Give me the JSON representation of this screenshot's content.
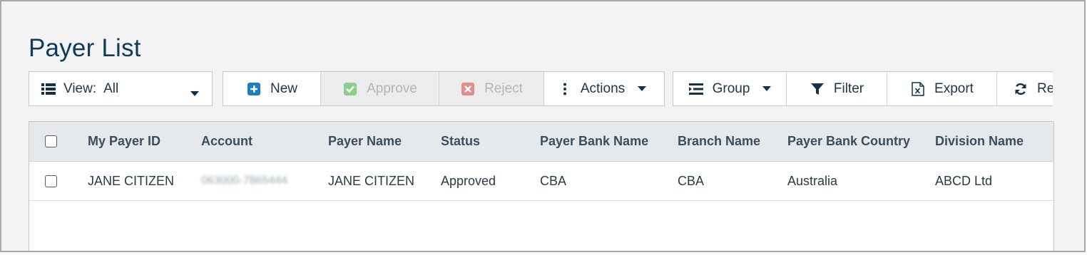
{
  "page": {
    "title": "Payer List"
  },
  "toolbar": {
    "view": {
      "label": "View:",
      "value": "All",
      "icon": "list-icon"
    },
    "new_label": "New",
    "approve_label": "Approve",
    "reject_label": "Reject",
    "actions_label": "Actions",
    "group_label": "Group",
    "filter_label": "Filter",
    "export_label": "Export",
    "refresh_label": "Re"
  },
  "colors": {
    "title": "#0e3b59",
    "new_icon": "#1a7fc1",
    "approve_icon": "#8ccf8c",
    "reject_icon": "#e48b8b",
    "header_bg": "#e5e9ec"
  },
  "grid": {
    "columns": [
      "My Payer ID",
      "Account",
      "Payer Name",
      "Status",
      "Payer Bank Name",
      "Branch Name",
      "Payer Bank Country",
      "Division Name"
    ],
    "rows": [
      {
        "my_payer_id": "JANE CITIZEN",
        "account": "063000-7865444",
        "payer_name": "JANE CITIZEN",
        "status": "Approved",
        "payer_bank_name": "CBA",
        "branch_name": "CBA",
        "payer_bank_country": "Australia",
        "division_name": "ABCD Ltd"
      }
    ]
  }
}
